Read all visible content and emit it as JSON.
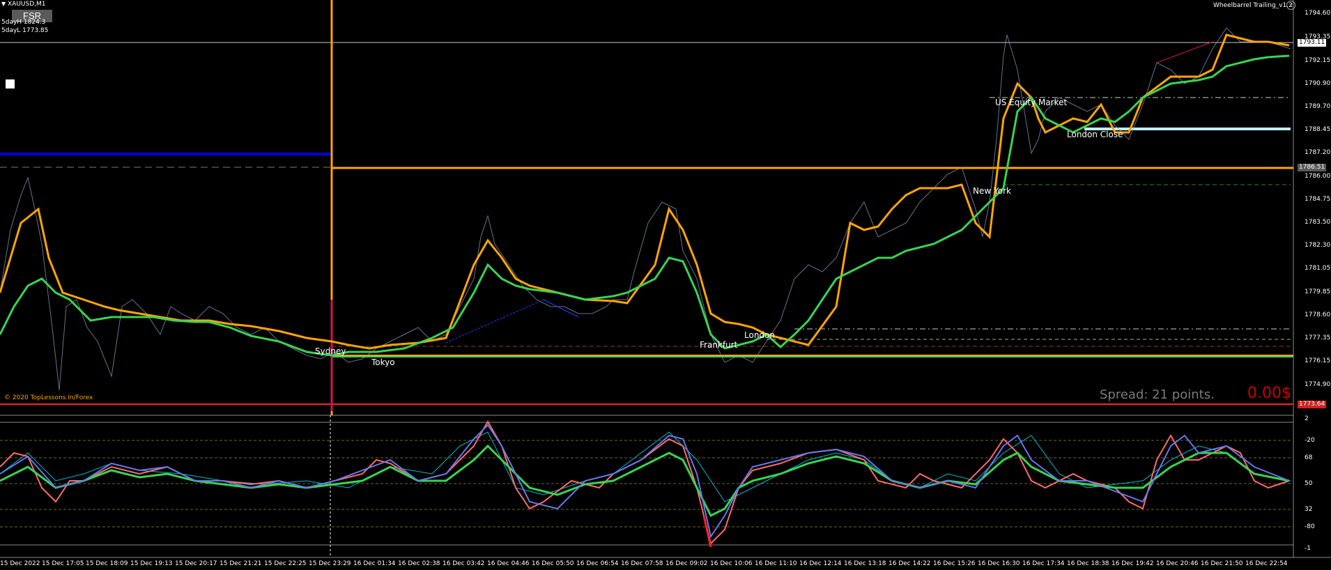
{
  "header": {
    "symbol": "XAUUSD,M1",
    "fsr_button": "FSR",
    "five_day_high": "5dayH 1824.3",
    "five_day_low": "5dayL 1773.85",
    "indicator_name": "Wheelbarrel Trailing_v1.2"
  },
  "icons": {
    "dropdown": "triangle-down-icon",
    "indicator_close": "close-icon",
    "marker": "white-square-icon"
  },
  "colors": {
    "background": "#000000",
    "orange": "#ffa500",
    "green": "#39d353",
    "blue": "#0000cc",
    "red": "#ff2a2a",
    "gray": "#8a8a8a"
  },
  "price_axis": {
    "labels": [
      "1794.60",
      "1793.35",
      "1792.15",
      "1790.90",
      "1789.70",
      "1788.45",
      "1787.20",
      "1786.00",
      "1784.75",
      "1783.50",
      "1782.30",
      "1781.05",
      "1779.85",
      "1778.60",
      "1777.35",
      "1776.15",
      "1774.90"
    ],
    "current_price": "1793.11",
    "orange_level": "1786.51",
    "red_level": "1773.64"
  },
  "sessions": [
    "Sydney",
    "Tokyo",
    "Frankfurt",
    "London",
    "New York",
    "US Equity Market",
    "London Close"
  ],
  "copyright": "© 2020 TopLessons.In/Forex",
  "spread": {
    "text": "Spread: 21 points.",
    "profit": "0.00$"
  },
  "osc_axis": {
    "labels": [
      "2",
      "-20",
      "68",
      "50",
      "32",
      "-80",
      "-1"
    ]
  },
  "time_axis": [
    "15 Dec 2022",
    "15 Dec 17:05",
    "15 Dec 18:09",
    "15 Dec 19:13",
    "15 Dec 20:17",
    "15 Dec 21:21",
    "15 Dec 22:25",
    "15 Dec 23:29",
    "16 Dec 01:34",
    "16 Dec 02:38",
    "16 Dec 03:42",
    "16 Dec 04:46",
    "16 Dec 05:50",
    "16 Dec 06:54",
    "16 Dec 07:58",
    "16 Dec 09:02",
    "16 Dec 10:06",
    "16 Dec 11:10",
    "16 Dec 12:14",
    "16 Dec 13:18",
    "16 Dec 14:22",
    "16 Dec 15:26",
    "16 Dec 16:30",
    "16 Dec 17:34",
    "16 Dec 18:38",
    "16 Dec 19:42",
    "16 Dec 20:46",
    "16 Dec 21:50",
    "16 Dec 22:54"
  ]
}
